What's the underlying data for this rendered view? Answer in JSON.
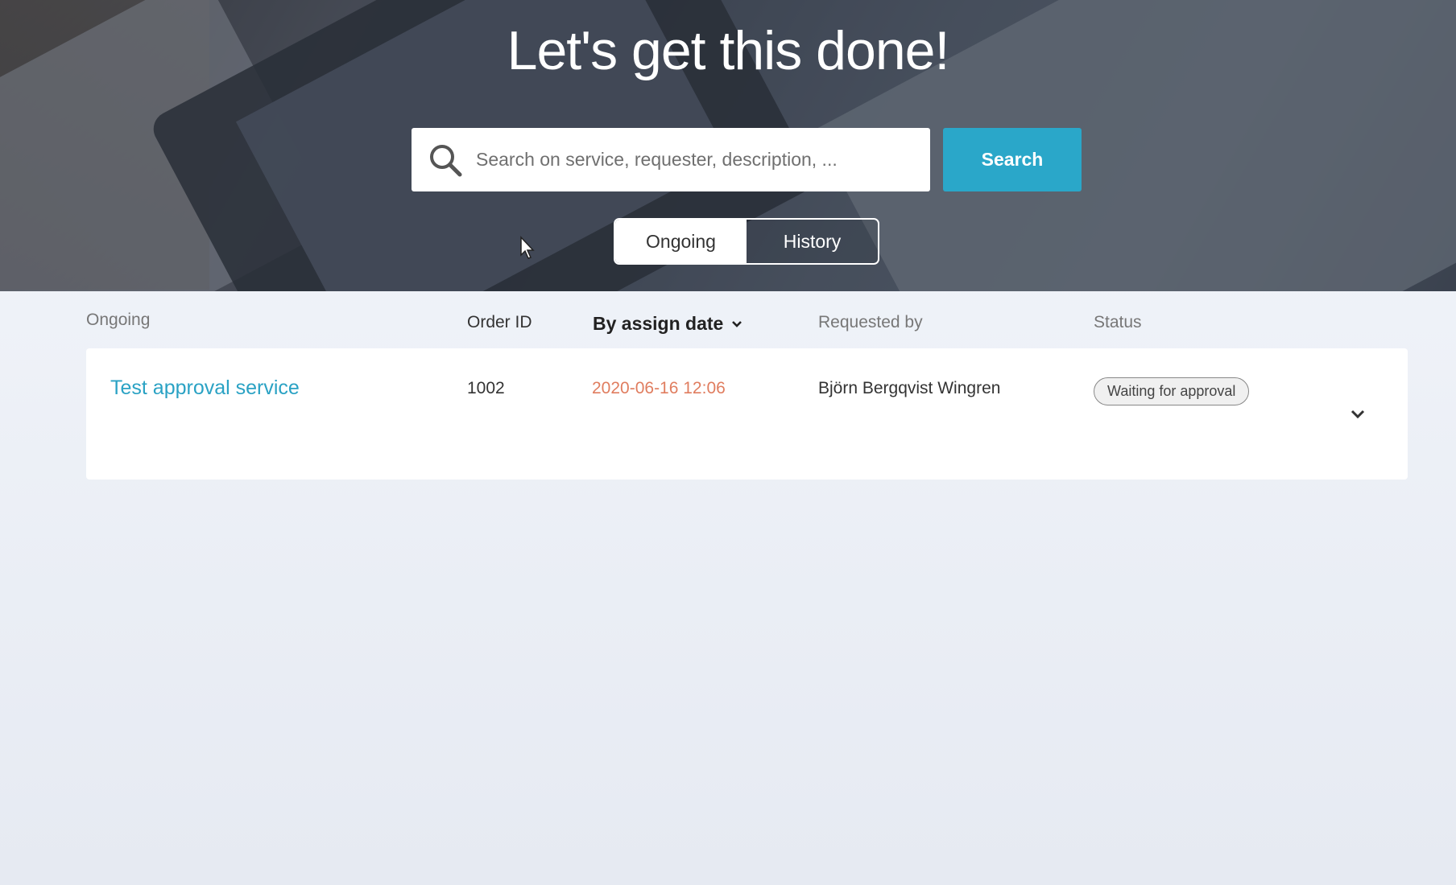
{
  "hero": {
    "title": "Let's get this done!"
  },
  "search": {
    "placeholder": "Search on service, requester, description, ...",
    "value": "",
    "button_label": "Search"
  },
  "view_toggle": {
    "options": [
      {
        "label": "Ongoing",
        "active": true
      },
      {
        "label": "History",
        "active": false
      }
    ]
  },
  "list": {
    "headers": {
      "section": "Ongoing",
      "order_id": "Order ID",
      "sort": "By assign date",
      "requested_by": "Requested by",
      "status": "Status"
    },
    "rows": [
      {
        "service": "Test approval service",
        "order_id": "1002",
        "assign_date": "2020-06-16 12:06",
        "requested_by": "Björn Bergqvist Wingren",
        "status": "Waiting for approval"
      }
    ]
  },
  "colors": {
    "accent": "#2aa7c9",
    "service_link": "#2aa2c4",
    "date": "#e07d5f"
  }
}
